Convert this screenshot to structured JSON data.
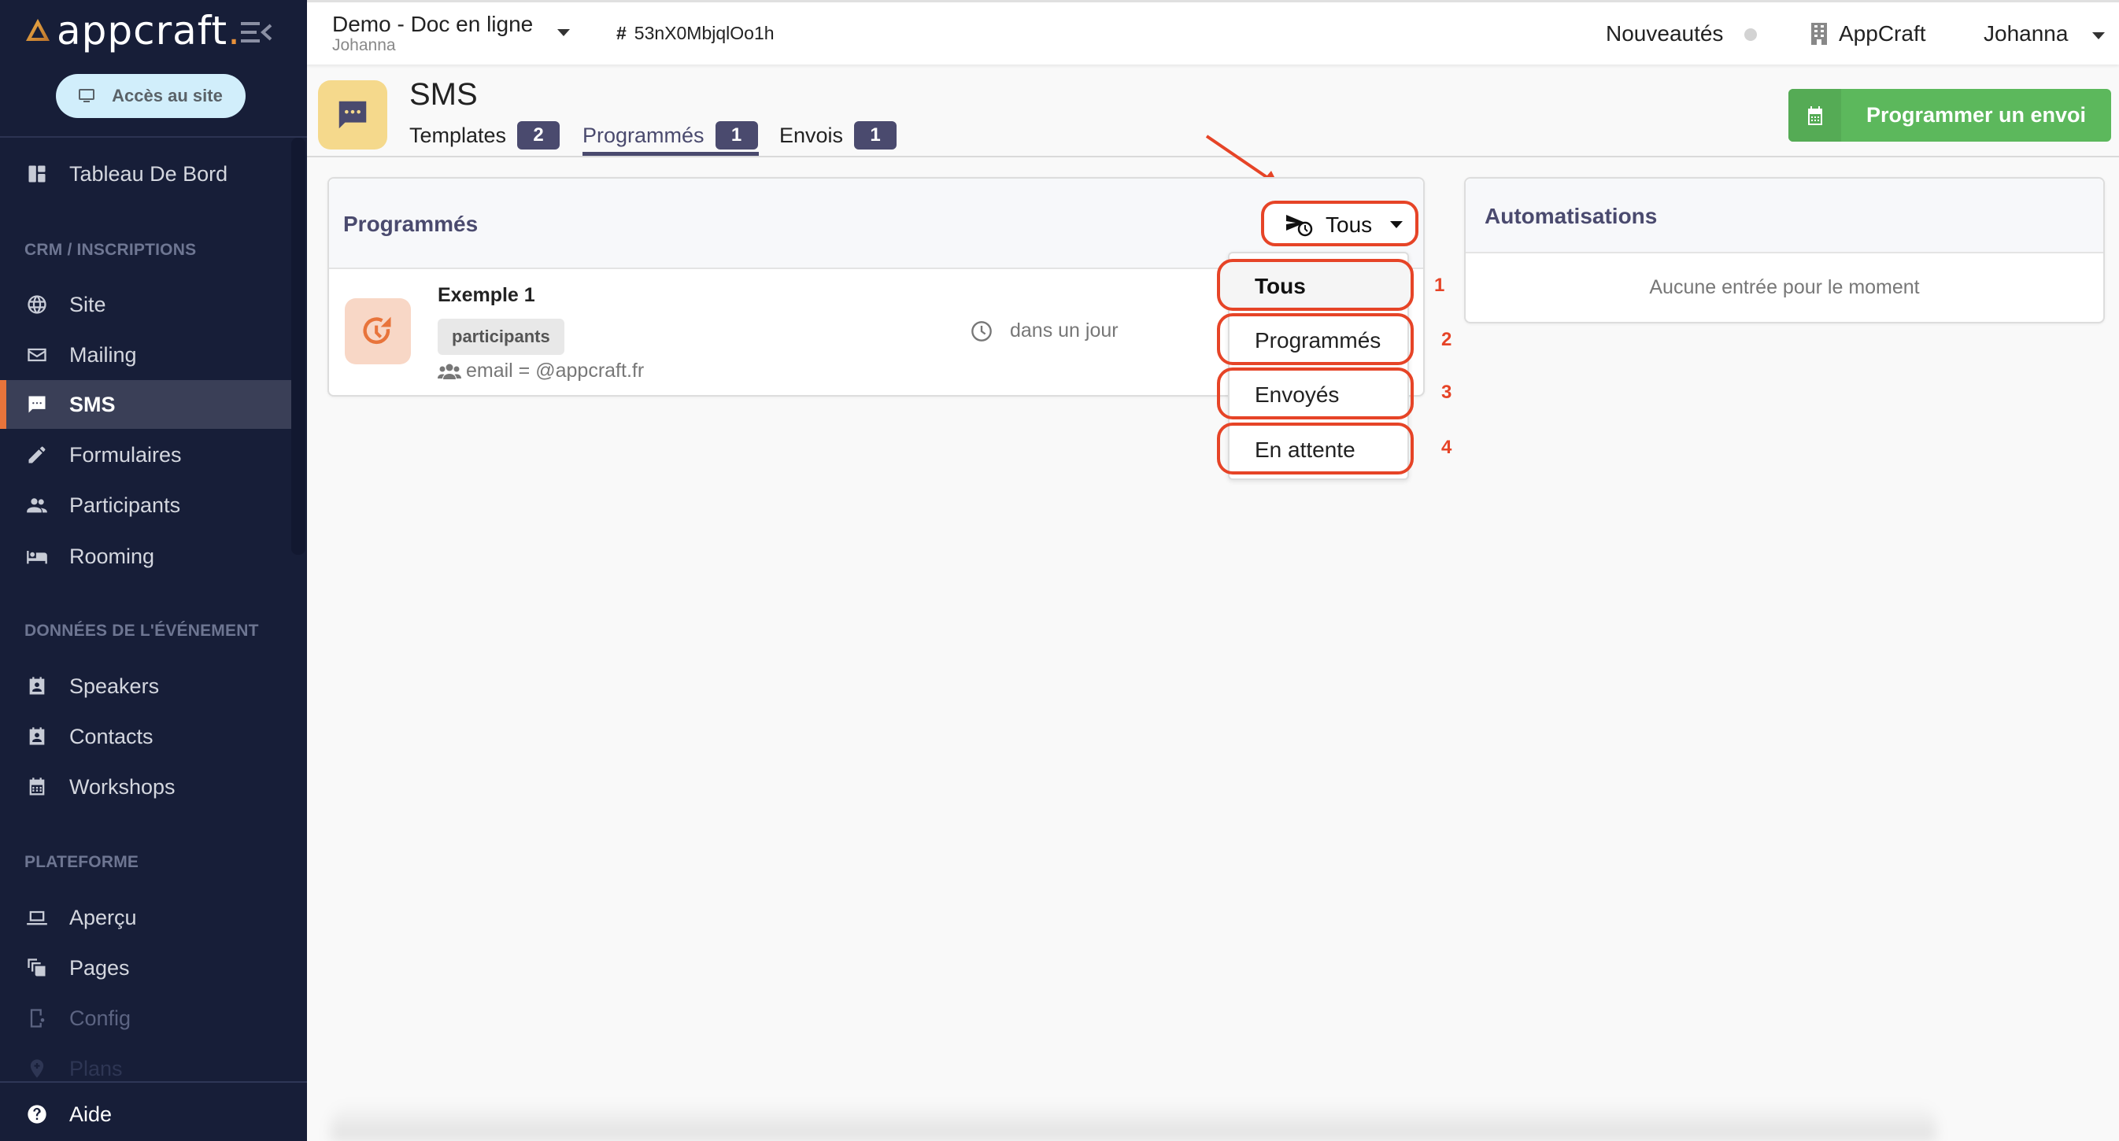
{
  "sidebar": {
    "brand": "appcraft",
    "site_button": "Accès au site",
    "items": [
      {
        "label": "Tableau De Bord",
        "icon": "dashboard-icon"
      },
      {
        "label": "Site",
        "icon": "globe-icon"
      },
      {
        "label": "Mailing",
        "icon": "mail-icon"
      },
      {
        "label": "SMS",
        "icon": "sms-icon",
        "active": true
      },
      {
        "label": "Formulaires",
        "icon": "pencil-icon"
      },
      {
        "label": "Participants",
        "icon": "people-icon"
      },
      {
        "label": "Rooming",
        "icon": "bed-icon"
      },
      {
        "label": "Speakers",
        "icon": "contact-card-icon"
      },
      {
        "label": "Contacts",
        "icon": "contact-card-icon"
      },
      {
        "label": "Workshops",
        "icon": "calendar-icon"
      },
      {
        "label": "Aperçu",
        "icon": "laptop-icon"
      },
      {
        "label": "Pages",
        "icon": "pages-icon"
      },
      {
        "label": "Config",
        "icon": "device-settings-icon"
      },
      {
        "label": "Plans",
        "icon": "map-pin-plus-icon"
      }
    ],
    "sections": [
      "CRM / INSCRIPTIONS",
      "DONNÉES DE L'ÉVÉNEMENT",
      "PLATEFORME"
    ],
    "help": "Aide"
  },
  "topbar": {
    "event_title": "Demo - Doc en ligne",
    "event_owner": "Johanna",
    "event_id": "53nX0MbjqlOo1h",
    "news": "Nouveautés",
    "org": "AppCraft",
    "user": "Johanna"
  },
  "page": {
    "title": "SMS",
    "tabs": [
      {
        "label": "Templates",
        "count": "2"
      },
      {
        "label": "Programmés",
        "count": "1",
        "active": true
      },
      {
        "label": "Envois",
        "count": "1"
      }
    ],
    "cta": "Programmer un envoi"
  },
  "scheduled": {
    "title": "Programmés",
    "filter": {
      "selected": "Tous",
      "options": [
        "Tous",
        "Programmés",
        "Envoyés",
        "En attente"
      ],
      "annotations": [
        "1",
        "2",
        "3",
        "4"
      ]
    },
    "items": [
      {
        "name": "Exemple 1",
        "tag": "participants",
        "filter": "email = @appcraft.fr",
        "when": "dans un jour"
      }
    ]
  },
  "automations": {
    "title": "Automatisations",
    "empty": "Aucune entrée pour le moment"
  },
  "colors": {
    "sidebar_bg": "#171e38",
    "accent_orange": "#e8743b",
    "primary": "#4a4a6e",
    "cta_green": "#5cb85c",
    "annotation_red": "#e64427"
  }
}
